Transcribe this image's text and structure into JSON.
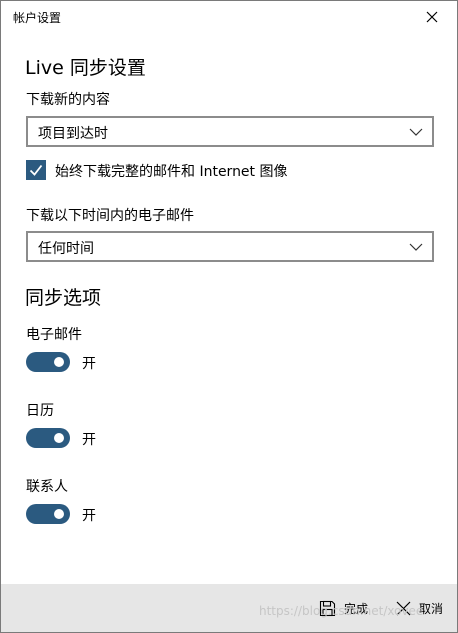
{
  "window": {
    "title": "帐户设置"
  },
  "live_sync": {
    "heading": "Live 同步设置",
    "download_new_label": "下载新的内容",
    "download_new_value": "项目到达时",
    "always_download_label": "始终下载完整的邮件和 Internet 图像",
    "always_download_checked": true,
    "download_range_label": "下载以下时间内的电子邮件",
    "download_range_value": "任何时间"
  },
  "sync_options": {
    "heading": "同步选项",
    "items": [
      {
        "label": "电子邮件",
        "state": "开",
        "on": true
      },
      {
        "label": "日历",
        "state": "开",
        "on": true
      },
      {
        "label": "联系人",
        "state": "开",
        "on": true
      }
    ]
  },
  "footer": {
    "done_label": "完成",
    "cancel_label": "取消",
    "watermark": "https://blog.csdn.net/xovee"
  },
  "colors": {
    "accent": "#2b5a80",
    "footer_bg": "#e6e6e6",
    "border": "#8c8c8c"
  },
  "icons": {
    "close": "close-icon",
    "chevron": "chevron-down-icon",
    "save": "save-icon",
    "check": "checkmark-icon"
  }
}
